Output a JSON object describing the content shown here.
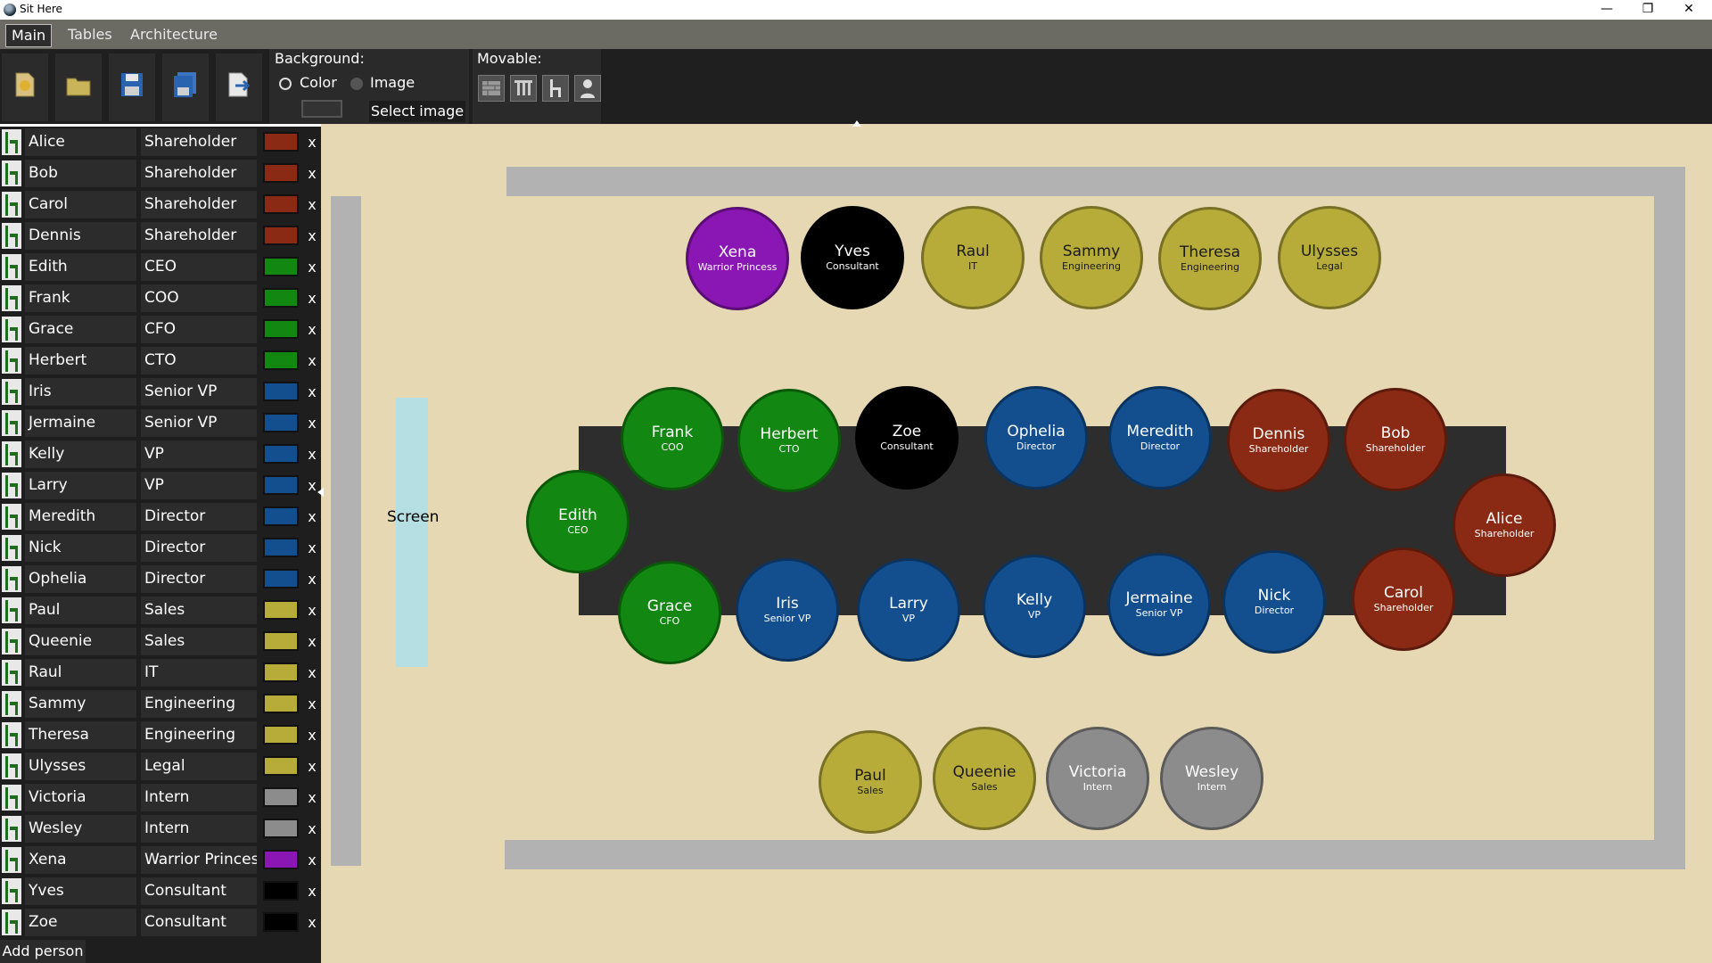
{
  "window": {
    "title": "Sit Here",
    "minimize": "—",
    "maximize": "❐",
    "close": "✕"
  },
  "tabs": [
    {
      "label": "Main",
      "active": true
    },
    {
      "label": "Tables",
      "active": false
    },
    {
      "label": "Architecture",
      "active": false
    }
  ],
  "toolbar": {
    "buttons": [
      "new-file-icon",
      "open-folder-icon",
      "save-icon",
      "save-as-icon",
      "export-icon"
    ],
    "background": {
      "label": "Background:",
      "color_label": "Color",
      "image_label": "Image",
      "select_image_label": "Select image",
      "selected": "Color"
    },
    "movable": {
      "label": "Movable:",
      "icons": [
        "walls-icon",
        "columns-icon",
        "chairs-icon",
        "person-icon"
      ]
    }
  },
  "colors": {
    "shareholder": "#8b2a14",
    "executive": "#128712",
    "vp_director": "#134f8f",
    "staff": "#b7ac39",
    "intern": "#8c8c8c",
    "warrior_princess": "#8a16b3",
    "consultant": "#000000"
  },
  "people": [
    {
      "name": "Alice",
      "role": "Shareholder",
      "color": "#8b2a14"
    },
    {
      "name": "Bob",
      "role": "Shareholder",
      "color": "#8b2a14"
    },
    {
      "name": "Carol",
      "role": "Shareholder",
      "color": "#8b2a14"
    },
    {
      "name": "Dennis",
      "role": "Shareholder",
      "color": "#8b2a14"
    },
    {
      "name": "Edith",
      "role": "CEO",
      "color": "#128712"
    },
    {
      "name": "Frank",
      "role": "COO",
      "color": "#128712"
    },
    {
      "name": "Grace",
      "role": "CFO",
      "color": "#128712"
    },
    {
      "name": "Herbert",
      "role": "CTO",
      "color": "#128712"
    },
    {
      "name": "Iris",
      "role": "Senior VP",
      "color": "#134f8f"
    },
    {
      "name": "Jermaine",
      "role": "Senior VP",
      "color": "#134f8f"
    },
    {
      "name": "Kelly",
      "role": "VP",
      "color": "#134f8f"
    },
    {
      "name": "Larry",
      "role": "VP",
      "color": "#134f8f"
    },
    {
      "name": "Meredith",
      "role": "Director",
      "color": "#134f8f"
    },
    {
      "name": "Nick",
      "role": "Director",
      "color": "#134f8f"
    },
    {
      "name": "Ophelia",
      "role": "Director",
      "color": "#134f8f"
    },
    {
      "name": "Paul",
      "role": "Sales",
      "color": "#b7ac39"
    },
    {
      "name": "Queenie",
      "role": "Sales",
      "color": "#b7ac39"
    },
    {
      "name": "Raul",
      "role": "IT",
      "color": "#b7ac39"
    },
    {
      "name": "Sammy",
      "role": "Engineering",
      "color": "#b7ac39"
    },
    {
      "name": "Theresa",
      "role": "Engineering",
      "color": "#b7ac39"
    },
    {
      "name": "Ulysses",
      "role": "Legal",
      "color": "#b7ac39"
    },
    {
      "name": "Victoria",
      "role": "Intern",
      "color": "#8c8c8c"
    },
    {
      "name": "Wesley",
      "role": "Intern",
      "color": "#8c8c8c"
    },
    {
      "name": "Xena",
      "role": "Warrior Princes",
      "color": "#8a16b3"
    },
    {
      "name": "Yves",
      "role": "Consultant",
      "color": "#000000"
    },
    {
      "name": "Zoe",
      "role": "Consultant",
      "color": "#000000"
    }
  ],
  "delete_label": "x",
  "add_person_label": "Add person",
  "room": {
    "screen_label": "Screen",
    "seated": [
      {
        "name": "Xena",
        "role": "Warrior Princess",
        "color": "#8a16b3"
      },
      {
        "name": "Yves",
        "role": "Consultant",
        "color": "#000000"
      },
      {
        "name": "Raul",
        "role": "IT",
        "color": "#b7ac39"
      },
      {
        "name": "Sammy",
        "role": "Engineering",
        "color": "#b7ac39"
      },
      {
        "name": "Theresa",
        "role": "Engineering",
        "color": "#b7ac39"
      },
      {
        "name": "Ulysses",
        "role": "Legal",
        "color": "#b7ac39"
      },
      {
        "name": "Frank",
        "role": "COO",
        "color": "#128712"
      },
      {
        "name": "Herbert",
        "role": "CTO",
        "color": "#128712"
      },
      {
        "name": "Zoe",
        "role": "Consultant",
        "color": "#000000"
      },
      {
        "name": "Ophelia",
        "role": "Director",
        "color": "#134f8f"
      },
      {
        "name": "Meredith",
        "role": "Director",
        "color": "#134f8f"
      },
      {
        "name": "Dennis",
        "role": "Shareholder",
        "color": "#8b2a14"
      },
      {
        "name": "Bob",
        "role": "Shareholder",
        "color": "#8b2a14"
      },
      {
        "name": "Edith",
        "role": "CEO",
        "color": "#128712"
      },
      {
        "name": "Alice",
        "role": "Shareholder",
        "color": "#8b2a14"
      },
      {
        "name": "Grace",
        "role": "CFO",
        "color": "#128712"
      },
      {
        "name": "Iris",
        "role": "Senior VP",
        "color": "#134f8f"
      },
      {
        "name": "Larry",
        "role": "VP",
        "color": "#134f8f"
      },
      {
        "name": "Kelly",
        "role": "VP",
        "color": "#134f8f"
      },
      {
        "name": "Jermaine",
        "role": "Senior VP",
        "color": "#134f8f"
      },
      {
        "name": "Nick",
        "role": "Director",
        "color": "#134f8f"
      },
      {
        "name": "Carol",
        "role": "Shareholder",
        "color": "#8b2a14"
      },
      {
        "name": "Paul",
        "role": "Sales",
        "color": "#b7ac39"
      },
      {
        "name": "Queenie",
        "role": "Sales",
        "color": "#b7ac39"
      },
      {
        "name": "Victoria",
        "role": "Intern",
        "color": "#8c8c8c"
      },
      {
        "name": "Wesley",
        "role": "Intern",
        "color": "#8c8c8c"
      }
    ]
  }
}
